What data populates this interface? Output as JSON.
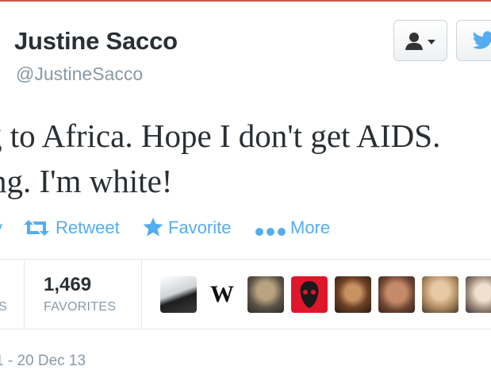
{
  "tweet": {
    "name": "Justine Sacco",
    "handle": "@JustineSacco",
    "text_line1": "g to Africa. Hope I don't get AIDS.",
    "text_line2": "ng. I'm white!"
  },
  "buttons": {
    "follow_icon": "user-icon",
    "twitter_icon": "twitter-bird-icon"
  },
  "actions": {
    "reply": "y",
    "retweet": "Retweet",
    "favorite": "Favorite",
    "more": "More"
  },
  "stats": {
    "cut_label": "S",
    "favorites_count": "1,469",
    "favorites_label": "FAVORITES"
  },
  "favoriters": {
    "avatars": [
      "avatar-1",
      "avatar-w",
      "avatar-3",
      "avatar-4",
      "avatar-5",
      "avatar-6",
      "avatar-7",
      "avatar-8"
    ],
    "w_letter": "W"
  },
  "timestamp": "1 - 20 Dec 13",
  "colors": {
    "accent": "#55acee",
    "text": "#292f33",
    "muted": "#8899a6"
  }
}
